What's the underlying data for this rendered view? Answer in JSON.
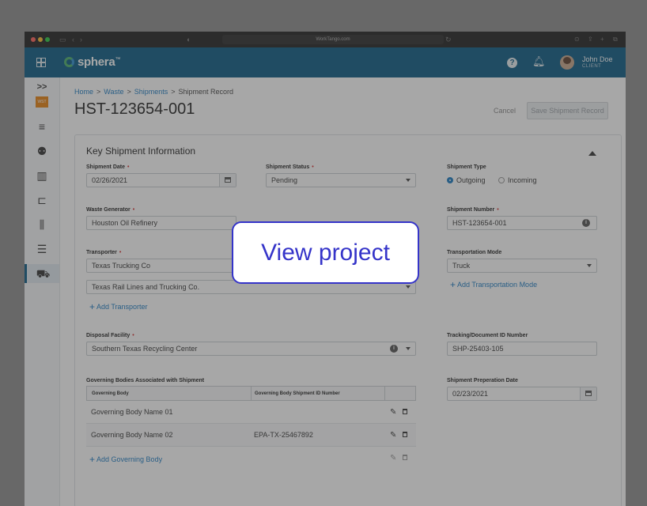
{
  "browser": {
    "url": "WorkTango.com"
  },
  "app": {
    "brand": "sphera",
    "brand_mark": "™"
  },
  "user": {
    "name": "John Doe",
    "role": "CLIENT"
  },
  "sidebar": {
    "expand_icon": ">>",
    "badge": "WST"
  },
  "breadcrumb": {
    "home": "Home",
    "waste": "Waste",
    "shipments": "Shipments",
    "current": "Shipment Record"
  },
  "page": {
    "title": "HST-123654-001",
    "cancel_label": "Cancel",
    "save_label": "Save Shipment Record"
  },
  "card": {
    "title": "Key Shipment Information"
  },
  "form": {
    "shipment_date": {
      "label": "Shipment Date",
      "value": "02/26/2021"
    },
    "shipment_status": {
      "label": "Shipment Status",
      "value": "Pending"
    },
    "shipment_type": {
      "label": "Shipment Type",
      "options": [
        "Outgoing",
        "Incoming"
      ],
      "selected": "Outgoing"
    },
    "waste_generator": {
      "label": "Waste Generator",
      "value": "Houston Oil Refinery"
    },
    "shipment_number": {
      "label": "Shipment Number",
      "value": "HST-123654-001"
    },
    "transporter": {
      "label": "Transporter",
      "value1": "Texas Trucking Co",
      "value2": "Texas Rail Lines and Trucking Co.",
      "add_label": "Add Transporter"
    },
    "transportation_mode": {
      "label": "Transportation Mode",
      "value": "Truck",
      "add_label": "Add Transportation Mode"
    },
    "disposal_facility": {
      "label": "Disposal Facility",
      "value": "Southern Texas Recycling Center"
    },
    "tracking_id": {
      "label": "Tracking/Document ID Number",
      "value": "SHP-25403-105"
    },
    "prep_date": {
      "label": "Shipment Preperation Date",
      "value": "02/23/2021"
    },
    "governing": {
      "label": "Governing Bodies Associated with Shipment",
      "columns": [
        "Governing Body",
        "Governing Body Shipment ID Number"
      ],
      "rows": [
        {
          "body": "Governing Body Name 01",
          "id": ""
        },
        {
          "body": "Governing Body Name 02",
          "id": "EPA-TX-25467892"
        }
      ],
      "add_label": "Add Governing Body"
    }
  },
  "overlay": {
    "cta_label": "View project"
  },
  "colors": {
    "primary": "#0a5a84",
    "link": "#1b7ac2",
    "required": "#d32f2f",
    "cta": "#3534c9"
  }
}
